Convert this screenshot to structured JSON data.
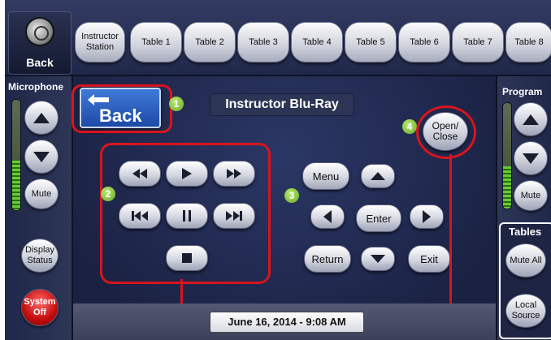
{
  "top_nav": {
    "back_label": "Back",
    "tabs": [
      "Instructor Station",
      "Table 1",
      "Table 2",
      "Table 3",
      "Table 4",
      "Table 5",
      "Table 6",
      "Table 7",
      "Table 8"
    ]
  },
  "microphone": {
    "title": "Microphone",
    "mute_label": "Mute",
    "display_status_label": "Display Status",
    "system_off_label": "System Off",
    "level": 0.45
  },
  "program": {
    "title": "Program",
    "mute_label": "Mute",
    "level": 0.4
  },
  "tables": {
    "title": "Tables",
    "mute_all_label": "Mute All",
    "local_source_label": "Local Source"
  },
  "main": {
    "back_label": "Back",
    "title": "Instructor Blu-Ray",
    "badges": [
      "1",
      "2",
      "3",
      "4"
    ],
    "open_close_label": "Open/ Close",
    "menu_label": "Menu",
    "enter_label": "Enter",
    "return_label": "Return",
    "exit_label": "Exit",
    "transport_icons": [
      "rewind-icon",
      "play-icon",
      "fast-forward-icon",
      "previous-chapter-icon",
      "pause-icon",
      "next-chapter-icon",
      "stop-icon"
    ]
  },
  "status": {
    "datetime": "June 16, 2014  -  9:08 AM"
  },
  "colors": {
    "annotation_red": "#d9141c",
    "badge_green": "#8fd14f",
    "back_blue": "#2f63c4",
    "system_off_red": "#c40c0c"
  }
}
